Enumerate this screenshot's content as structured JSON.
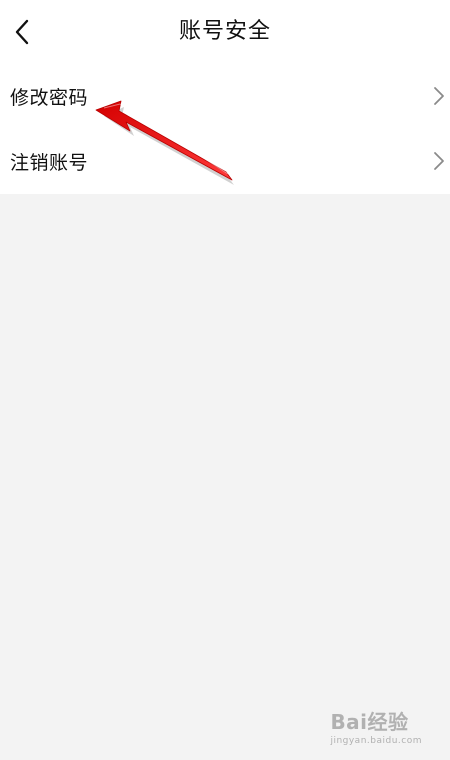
{
  "header": {
    "title": "账号安全",
    "back_icon": "chevron-left-icon"
  },
  "menu": {
    "items": [
      {
        "label": "修改密码",
        "icon": "chevron-right-icon"
      },
      {
        "label": "注销账号",
        "icon": "chevron-right-icon"
      }
    ]
  },
  "annotation": {
    "color": "#e8141a",
    "icon": "red-arrow-icon"
  },
  "watermark": {
    "brand": "Bai经验",
    "url": "jingyan.baidu.com"
  },
  "colors": {
    "background": "#f3f3f3",
    "surface": "#ffffff",
    "text": "#111111",
    "chevron": "#8a8a8a"
  }
}
